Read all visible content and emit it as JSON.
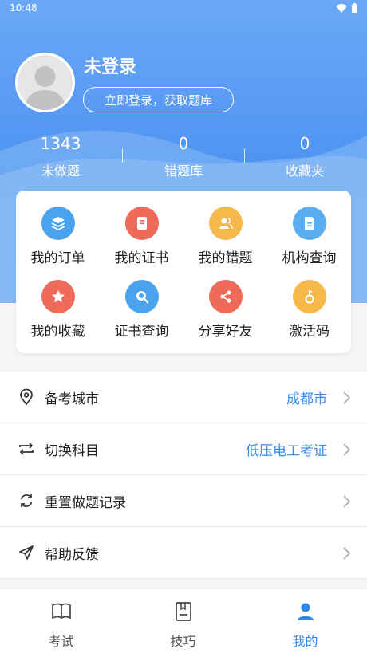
{
  "status_bar": {
    "time": "10:48"
  },
  "profile": {
    "name": "未登录",
    "login_button": "立即登录，获取题库"
  },
  "stats": [
    {
      "value": "1343",
      "label": "未做题"
    },
    {
      "value": "0",
      "label": "错题库"
    },
    {
      "value": "0",
      "label": "收藏夹"
    }
  ],
  "grid": [
    {
      "label": "我的订单",
      "icon": "layers-icon",
      "color": "#4aa3ee"
    },
    {
      "label": "我的证书",
      "icon": "certificate-icon",
      "color": "#f06a5a"
    },
    {
      "label": "我的错题",
      "icon": "people-icon",
      "color": "#f6b84a"
    },
    {
      "label": "机构查询",
      "icon": "document-icon",
      "color": "#58aef0"
    },
    {
      "label": "我的收藏",
      "icon": "star-icon",
      "color": "#f06a5a"
    },
    {
      "label": "证书查询",
      "icon": "search-icon",
      "color": "#4aa3ee"
    },
    {
      "label": "分享好友",
      "icon": "share-icon",
      "color": "#f06a5a"
    },
    {
      "label": "激活码",
      "icon": "key-icon",
      "color": "#f6b84a"
    }
  ],
  "menu": [
    {
      "label": "备考城市",
      "value": "成都市",
      "icon": "location-pin-icon"
    },
    {
      "label": "切换科目",
      "value": "低压电工考证",
      "icon": "switch-arrows-icon"
    },
    {
      "label": "重置做题记录",
      "value": "",
      "icon": "refresh-icon"
    },
    {
      "label": "帮助反馈",
      "value": "",
      "icon": "send-icon"
    }
  ],
  "tabs": [
    {
      "label": "考试",
      "icon": "book-icon"
    },
    {
      "label": "技巧",
      "icon": "notebook-icon"
    },
    {
      "label": "我的",
      "icon": "user-icon",
      "active": true
    }
  ],
  "colors": {
    "primary": "#4f93f2",
    "accent_text": "#3a8ee6",
    "active_tab": "#2f86ea"
  }
}
